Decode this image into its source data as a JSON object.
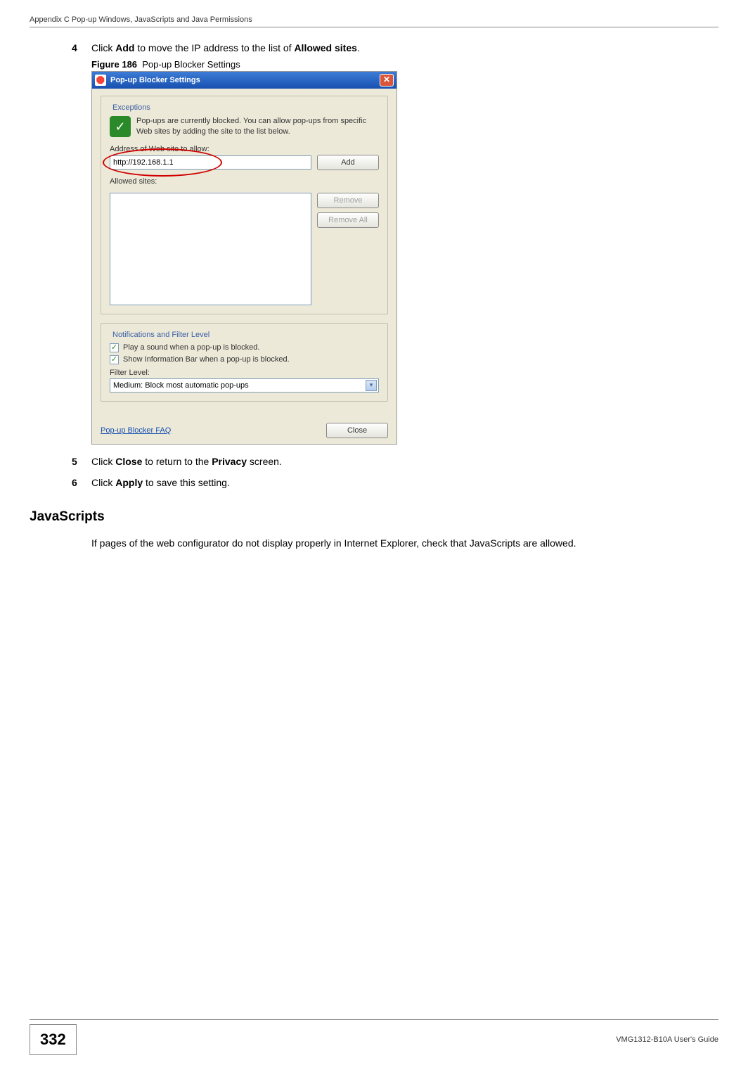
{
  "header": {
    "title": "Appendix C Pop-up Windows, JavaScripts and Java Permissions"
  },
  "steps": {
    "s4": {
      "num": "4",
      "pre": "Click ",
      "b1": "Add",
      "mid": " to move the IP address to the list of ",
      "b2": "Allowed sites",
      "post": "."
    },
    "s5": {
      "num": "5",
      "pre": "Click ",
      "b1": "Close",
      "mid": " to return to the ",
      "b2": "Privacy",
      "post": " screen."
    },
    "s6": {
      "num": "6",
      "pre": "Click ",
      "b1": "Apply",
      "post": " to save this setting."
    }
  },
  "figure": {
    "label": "Figure 186",
    "caption": "Pop-up Blocker Settings"
  },
  "dialog": {
    "title": "Pop-up Blocker Settings",
    "exceptions": {
      "legend": "Exceptions",
      "desc": "Pop-ups are currently blocked. You can allow pop-ups from specific Web sites by adding the site to the list below.",
      "addr_label": "Address of Web site to allow:",
      "addr_value": "http://192.168.1.1",
      "add_btn": "Add",
      "allowed_label": "Allowed sites:",
      "remove_btn": "Remove",
      "remove_all_btn": "Remove All"
    },
    "notifications": {
      "legend": "Notifications and Filter Level",
      "play_sound": "Play a sound when a pop-up is blocked.",
      "show_info": "Show Information Bar when a pop-up is blocked.",
      "filter_label": "Filter Level:",
      "filter_value": "Medium: Block most automatic pop-ups"
    },
    "footer": {
      "faq": "Pop-up Blocker FAQ",
      "close": "Close"
    }
  },
  "javascripts": {
    "heading": "JavaScripts",
    "para": "If pages of the web configurator do not display properly in Internet Explorer, check that JavaScripts are allowed."
  },
  "footer": {
    "page": "332",
    "guide": "VMG1312-B10A User's Guide"
  }
}
